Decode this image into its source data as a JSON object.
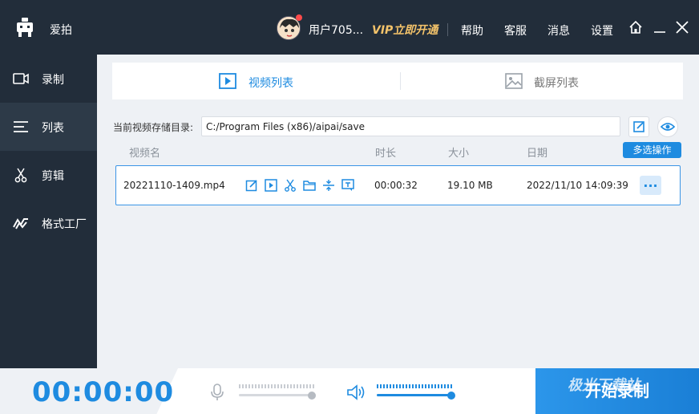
{
  "app": {
    "name": "爱拍"
  },
  "titlebar": {
    "username": "用户705...",
    "vip_label": "VIP立即开通",
    "links": [
      "帮助",
      "客服",
      "消息",
      "设置"
    ]
  },
  "sidebar": {
    "items": [
      {
        "label": "录制",
        "icon": "video-camera-icon",
        "active": false
      },
      {
        "label": "列表",
        "icon": "list-icon",
        "active": true
      },
      {
        "label": "剪辑",
        "icon": "scissors-icon",
        "active": false
      },
      {
        "label": "格式工厂",
        "icon": "format-factory-icon",
        "active": false
      }
    ]
  },
  "tabs": [
    {
      "label": "视频列表",
      "icon": "play-square-icon",
      "active": true
    },
    {
      "label": "截屏列表",
      "icon": "image-icon",
      "active": false
    }
  ],
  "storage": {
    "label": "当前视频存储目录:",
    "path": "C:/Program Files (x86)/aipai/save"
  },
  "table": {
    "headers": {
      "name": "视频名",
      "duration": "时长",
      "size": "大小",
      "date": "日期"
    },
    "multi_select_label": "多选操作",
    "rows": [
      {
        "name": "20221110-1409.mp4",
        "duration": "00:00:32",
        "size": "19.10 MB",
        "date": "2022/11/10 14:09:39",
        "more": "..."
      }
    ]
  },
  "bottom": {
    "timer": "00:00:00",
    "mic_volume": 0.95,
    "speaker_volume": 0.97,
    "start_label": "开始录制"
  },
  "watermark": "极光下载站",
  "colors": {
    "accent": "#1e8be0",
    "vip": "#f4c36a",
    "sidebar_bg": "#222d3a"
  }
}
